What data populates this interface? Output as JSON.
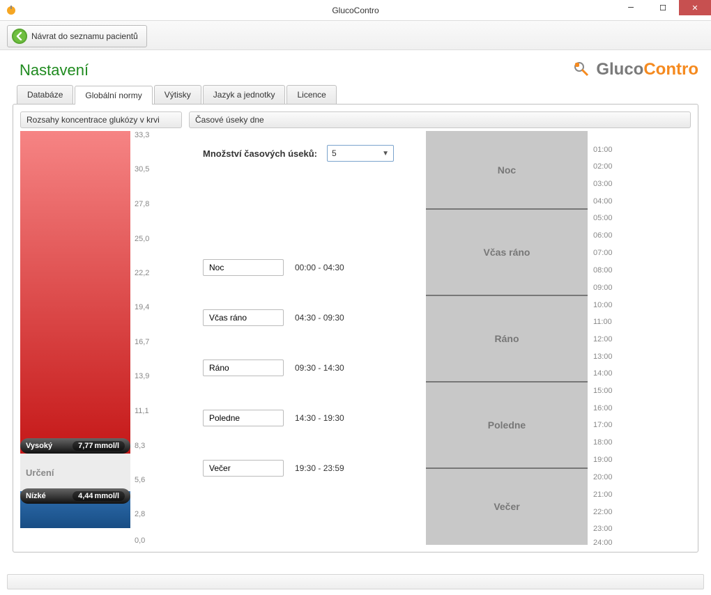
{
  "window": {
    "title": "GlucoContro"
  },
  "back_button": {
    "label": "Návrat do seznamu pacientů"
  },
  "page_title": "Nastavení",
  "brand": {
    "part1": "Gluco",
    "part2": "Contro"
  },
  "tabs": {
    "t0": "Databáze",
    "t1": "Globální normy",
    "t2": "Výtisky",
    "t3": "Jazyk a jednotky",
    "t4": "Licence",
    "active_index": 1
  },
  "glucose_panel": {
    "header": "Rozsahy koncentrace glukózy v krvi",
    "high_label": "Vysoký",
    "high_value": "7,77",
    "unit": "mmol/l",
    "target_label": "Určení",
    "low_label": "Nízké",
    "low_value": "4,44",
    "ticks": {
      "t0": "33,3",
      "t1": "30,5",
      "t2": "27,8",
      "t3": "25,0",
      "t4": "22,2",
      "t5": "19,4",
      "t6": "16,7",
      "t7": "13,9",
      "t8": "11,1",
      "t9": "8,3",
      "t10": "5,6",
      "t11": "2,8",
      "t12": "0,0"
    }
  },
  "time_panel": {
    "header": "Časové úseky dne",
    "count_label": "Množství časových úseků:",
    "count_value": "5",
    "segments": {
      "s0": {
        "name": "Noc",
        "range": "00:00 - 04:30"
      },
      "s1": {
        "name": "Včas ráno",
        "range": "04:30 - 09:30"
      },
      "s2": {
        "name": "Ráno",
        "range": "09:30 - 14:30"
      },
      "s3": {
        "name": "Poledne",
        "range": "14:30 - 19:30"
      },
      "s4": {
        "name": "Večer",
        "range": "19:30 - 23:59"
      }
    },
    "hours": {
      "h1": "01:00",
      "h2": "02:00",
      "h3": "03:00",
      "h4": "04:00",
      "h5": "05:00",
      "h6": "06:00",
      "h7": "07:00",
      "h8": "08:00",
      "h9": "09:00",
      "h10": "10:00",
      "h11": "11:00",
      "h12": "12:00",
      "h13": "13:00",
      "h14": "14:00",
      "h15": "15:00",
      "h16": "16:00",
      "h17": "17:00",
      "h18": "18:00",
      "h19": "19:00",
      "h20": "20:00",
      "h21": "21:00",
      "h22": "22:00",
      "h23": "23:00",
      "h24": "24:00"
    }
  }
}
